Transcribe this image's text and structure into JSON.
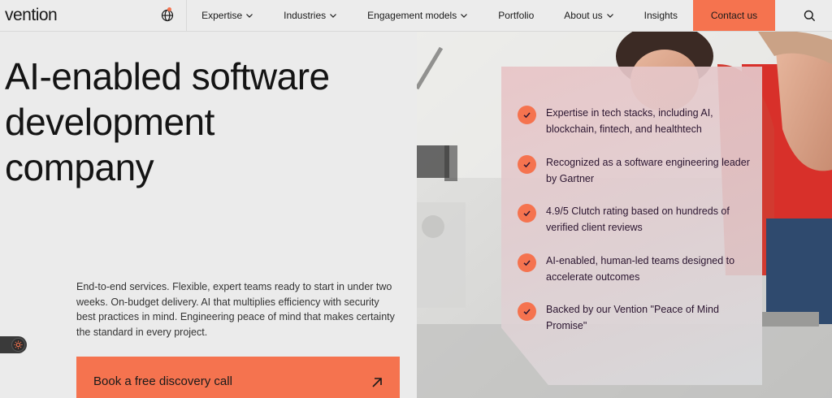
{
  "colors": {
    "accent": "#f5734f",
    "text_dark": "#141414",
    "card_text": "#2b1530"
  },
  "header": {
    "logo": "vention",
    "globe_icon": "globe-icon",
    "nav": [
      {
        "label": "Expertise",
        "has_dropdown": true
      },
      {
        "label": "Industries",
        "has_dropdown": true
      },
      {
        "label": "Engagement models",
        "has_dropdown": true
      },
      {
        "label": "Portfolio",
        "has_dropdown": false
      },
      {
        "label": "About us",
        "has_dropdown": true
      },
      {
        "label": "Insights",
        "has_dropdown": false
      }
    ],
    "contact_label": "Contact us",
    "search_icon": "search-icon"
  },
  "hero": {
    "title_lines": [
      "AI-enabled software",
      "development",
      "company"
    ],
    "description": "End-to-end services. Flexible, expert teams ready to start in under two weeks. On-budget delivery. AI that multiplies efficiency with security best practices in mind. Engineering peace of mind that makes certainty the standard in every project.",
    "cta_label": "Book a free discovery call",
    "cta_icon": "arrow-up-right-icon",
    "toggle_icon": "sun-icon"
  },
  "card": {
    "items": [
      "Expertise in tech stacks, including AI, blockchain, fintech, and healthtech",
      "Recognized as a software engineering leader by Gartner",
      "4.9/5 Clutch rating based on hundreds of verified client reviews",
      "AI-enabled, human-led teams designed to accelerate outcomes",
      "Backed by our Vention \"Peace of Mind Promise\""
    ],
    "check_icon": "check-icon"
  }
}
